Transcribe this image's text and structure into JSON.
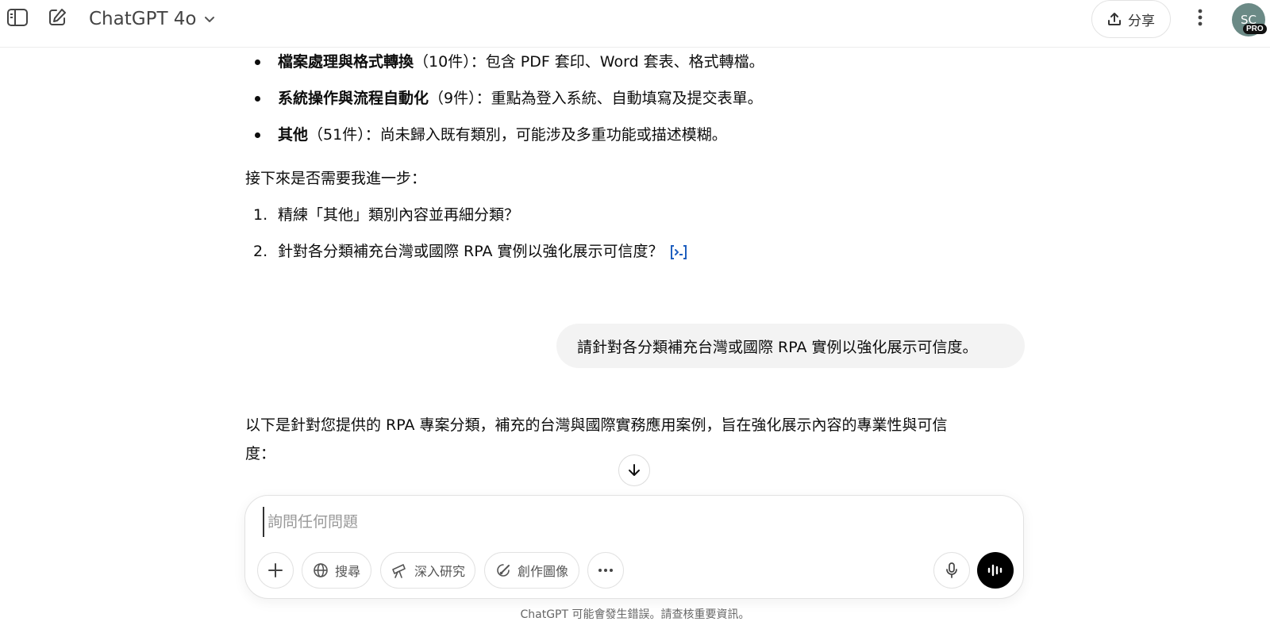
{
  "header": {
    "model_name": "ChatGPT 4o",
    "share_label": "分享",
    "avatar_initials": "SC",
    "avatar_badge": "PRO"
  },
  "assistant_prev": {
    "bullets": [
      {
        "bold": "檔案處理與格式轉換",
        "rest": "（10件）：包含 PDF 套印、Word 套表、格式轉檔。"
      },
      {
        "bold": "系統操作與流程自動化",
        "rest": "（9件）：重點為登入系統、自動填寫及提交表單。"
      },
      {
        "bold": "其他",
        "rest": "（51件）：尚未歸入既有類別，可能涉及多重功能或描述模糊。"
      }
    ],
    "followup_intro": "接下來是否需要我進一步：",
    "options": [
      {
        "num": "1.",
        "text": "精練「其他」類別內容並再細分類？"
      },
      {
        "num": "2.",
        "text": "針對各分類補充台灣或國際 RPA 實例以強化展示可信度？"
      }
    ]
  },
  "user_message": "請針對各分類補充台灣或國際 RPA 實例以強化展示可信度。",
  "assistant_reply": {
    "line1": "以下是針對您提供的 RPA 專案分類，補充的台灣與國際實務應用案例，旨在強化展示內容的專業性與可信",
    "line2": "度："
  },
  "composer": {
    "placeholder": "詢問任何問題",
    "tools": {
      "search": "搜尋",
      "deep_research": "深入研究",
      "create_image": "創作圖像"
    }
  },
  "footer": "ChatGPT 可能會發生錯誤。請查核重要資訊。"
}
